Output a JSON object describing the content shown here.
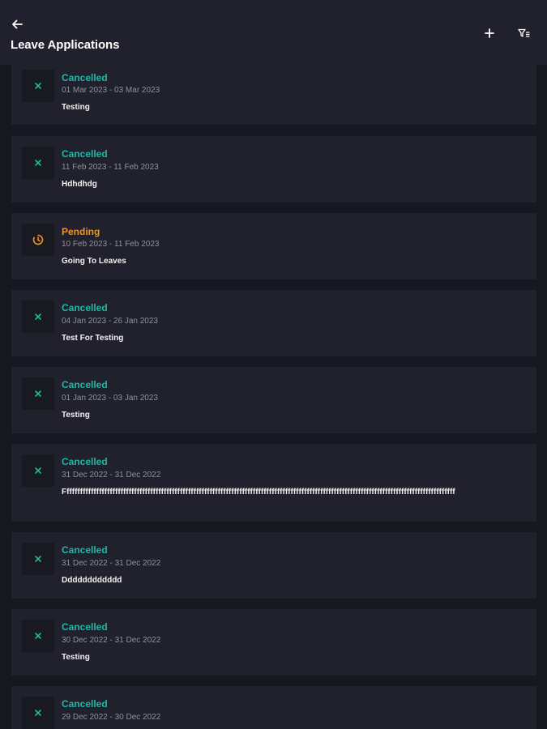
{
  "header": {
    "title": "Leave Applications",
    "back_icon": "arrow-left-icon",
    "add_icon": "plus-icon",
    "filter_icon": "filter-icon"
  },
  "colors": {
    "cancelled": "#1fb8a6",
    "pending": "#f0961c",
    "card_bg": "#20212d",
    "page_bg": "#16171f"
  },
  "leaves": [
    {
      "status": "Cancelled",
      "dates": "01 Mar 2023 - 03 Mar 2023",
      "reason": "Testing"
    },
    {
      "status": "Cancelled",
      "dates": "11 Feb 2023 - 11 Feb 2023",
      "reason": "Hdhdhdg"
    },
    {
      "status": "Pending",
      "dates": "10 Feb 2023 - 11 Feb 2023",
      "reason": "Going To Leaves"
    },
    {
      "status": "Cancelled",
      "dates": "04 Jan 2023 - 26 Jan 2023",
      "reason": "Test For Testing"
    },
    {
      "status": "Cancelled",
      "dates": "01 Jan 2023 - 03 Jan 2023",
      "reason": "Testing"
    },
    {
      "status": "Cancelled",
      "dates": "31 Dec 2022 - 31 Dec 2022",
      "reason": "Fffffffffffffffffffffffffffffffffffffffffffffffffffffffffffffffffffffffffffffffffffffffffffffffffffffffffffffffffffffffffffffffffffffffffffffffff"
    },
    {
      "status": "Cancelled",
      "dates": "31 Dec 2022 - 31 Dec 2022",
      "reason": "Dddddddddddd"
    },
    {
      "status": "Cancelled",
      "dates": "30 Dec 2022 - 31 Dec 2022",
      "reason": "Testing"
    },
    {
      "status": "Cancelled",
      "dates": "29 Dec 2022 - 30 Dec 2022",
      "reason": ""
    }
  ]
}
